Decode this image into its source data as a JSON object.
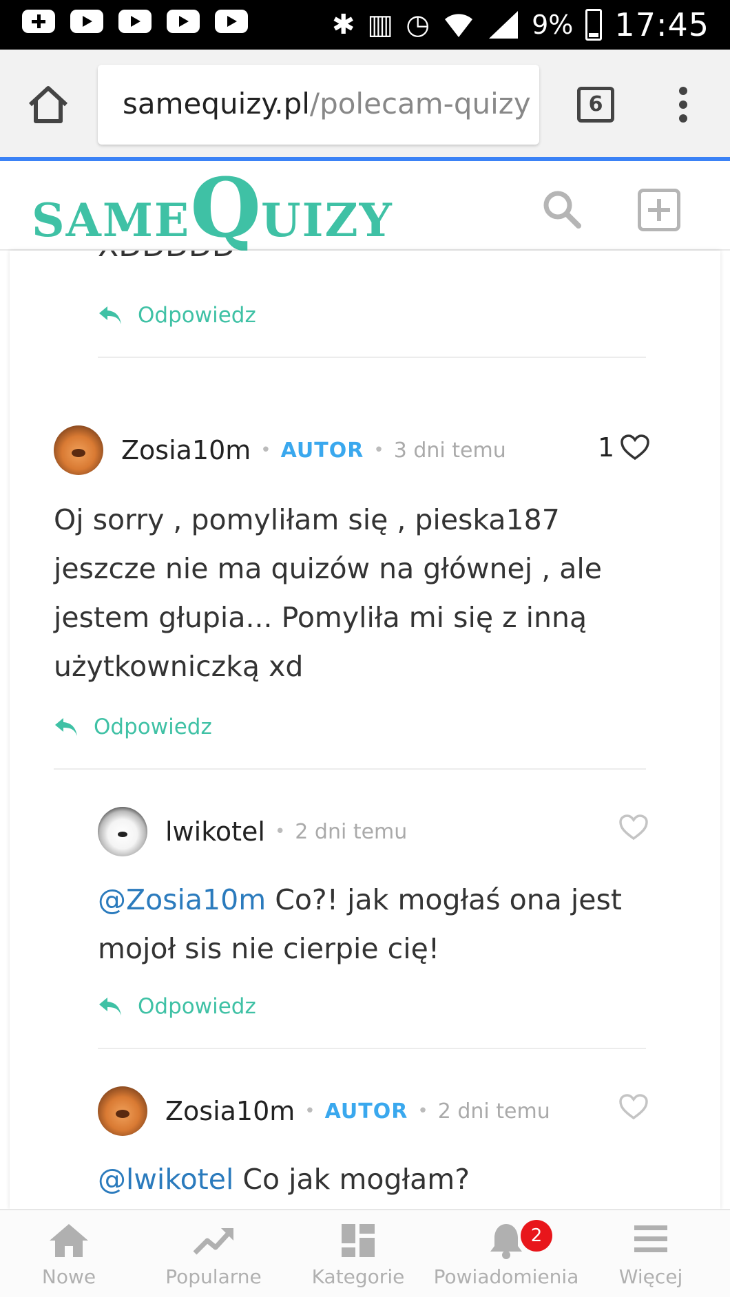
{
  "status_bar": {
    "battery": "9%",
    "time": "17:45"
  },
  "browser": {
    "url_host": "samequizy.pl",
    "url_path": "/polecam-quizy",
    "tab_count": "6"
  },
  "site": {
    "logo_part1": "SAME",
    "logo_q": "Q",
    "logo_part2": "UIZY"
  },
  "partial_comment": {
    "text": "XDDDDD",
    "reply_label": "Odpowiedz"
  },
  "comments": [
    {
      "username": "Zosia10m",
      "badge": "AUTOR",
      "time": "3 dni temu",
      "likes": "1",
      "body": "Oj sorry , pomyliłam się , pieska187 jeszcze nie ma quizów na głównej , ale jestem głupia... Pomyliła mi się z inną użytkowniczką xd",
      "reply_label": "Odpowiedz"
    },
    {
      "username": "lwikotel",
      "time": "2 dni temu",
      "mention": "@Zosia10m",
      "body": " Co?! jak mogłaś ona jest mojoł sis nie cierpie cię!",
      "reply_label": "Odpowiedz"
    },
    {
      "username": "Zosia10m",
      "badge": "AUTOR",
      "time": "2 dni temu",
      "mention": "@lwikotel",
      "body": " Co jak mogłam?"
    }
  ],
  "bottom_nav": {
    "items": [
      {
        "label": "Nowe",
        "icon": "home-icon"
      },
      {
        "label": "Popularne",
        "icon": "trending-icon"
      },
      {
        "label": "Kategorie",
        "icon": "grid-icon"
      },
      {
        "label": "Powiadomienia",
        "icon": "bell-icon",
        "badge": "2"
      },
      {
        "label": "Więcej",
        "icon": "menu-icon"
      }
    ]
  },
  "colors": {
    "brand": "#3fc1a5",
    "author_badge": "#3aa8ee",
    "mention": "#2b7bbd",
    "notification_badge": "#e8161b"
  }
}
